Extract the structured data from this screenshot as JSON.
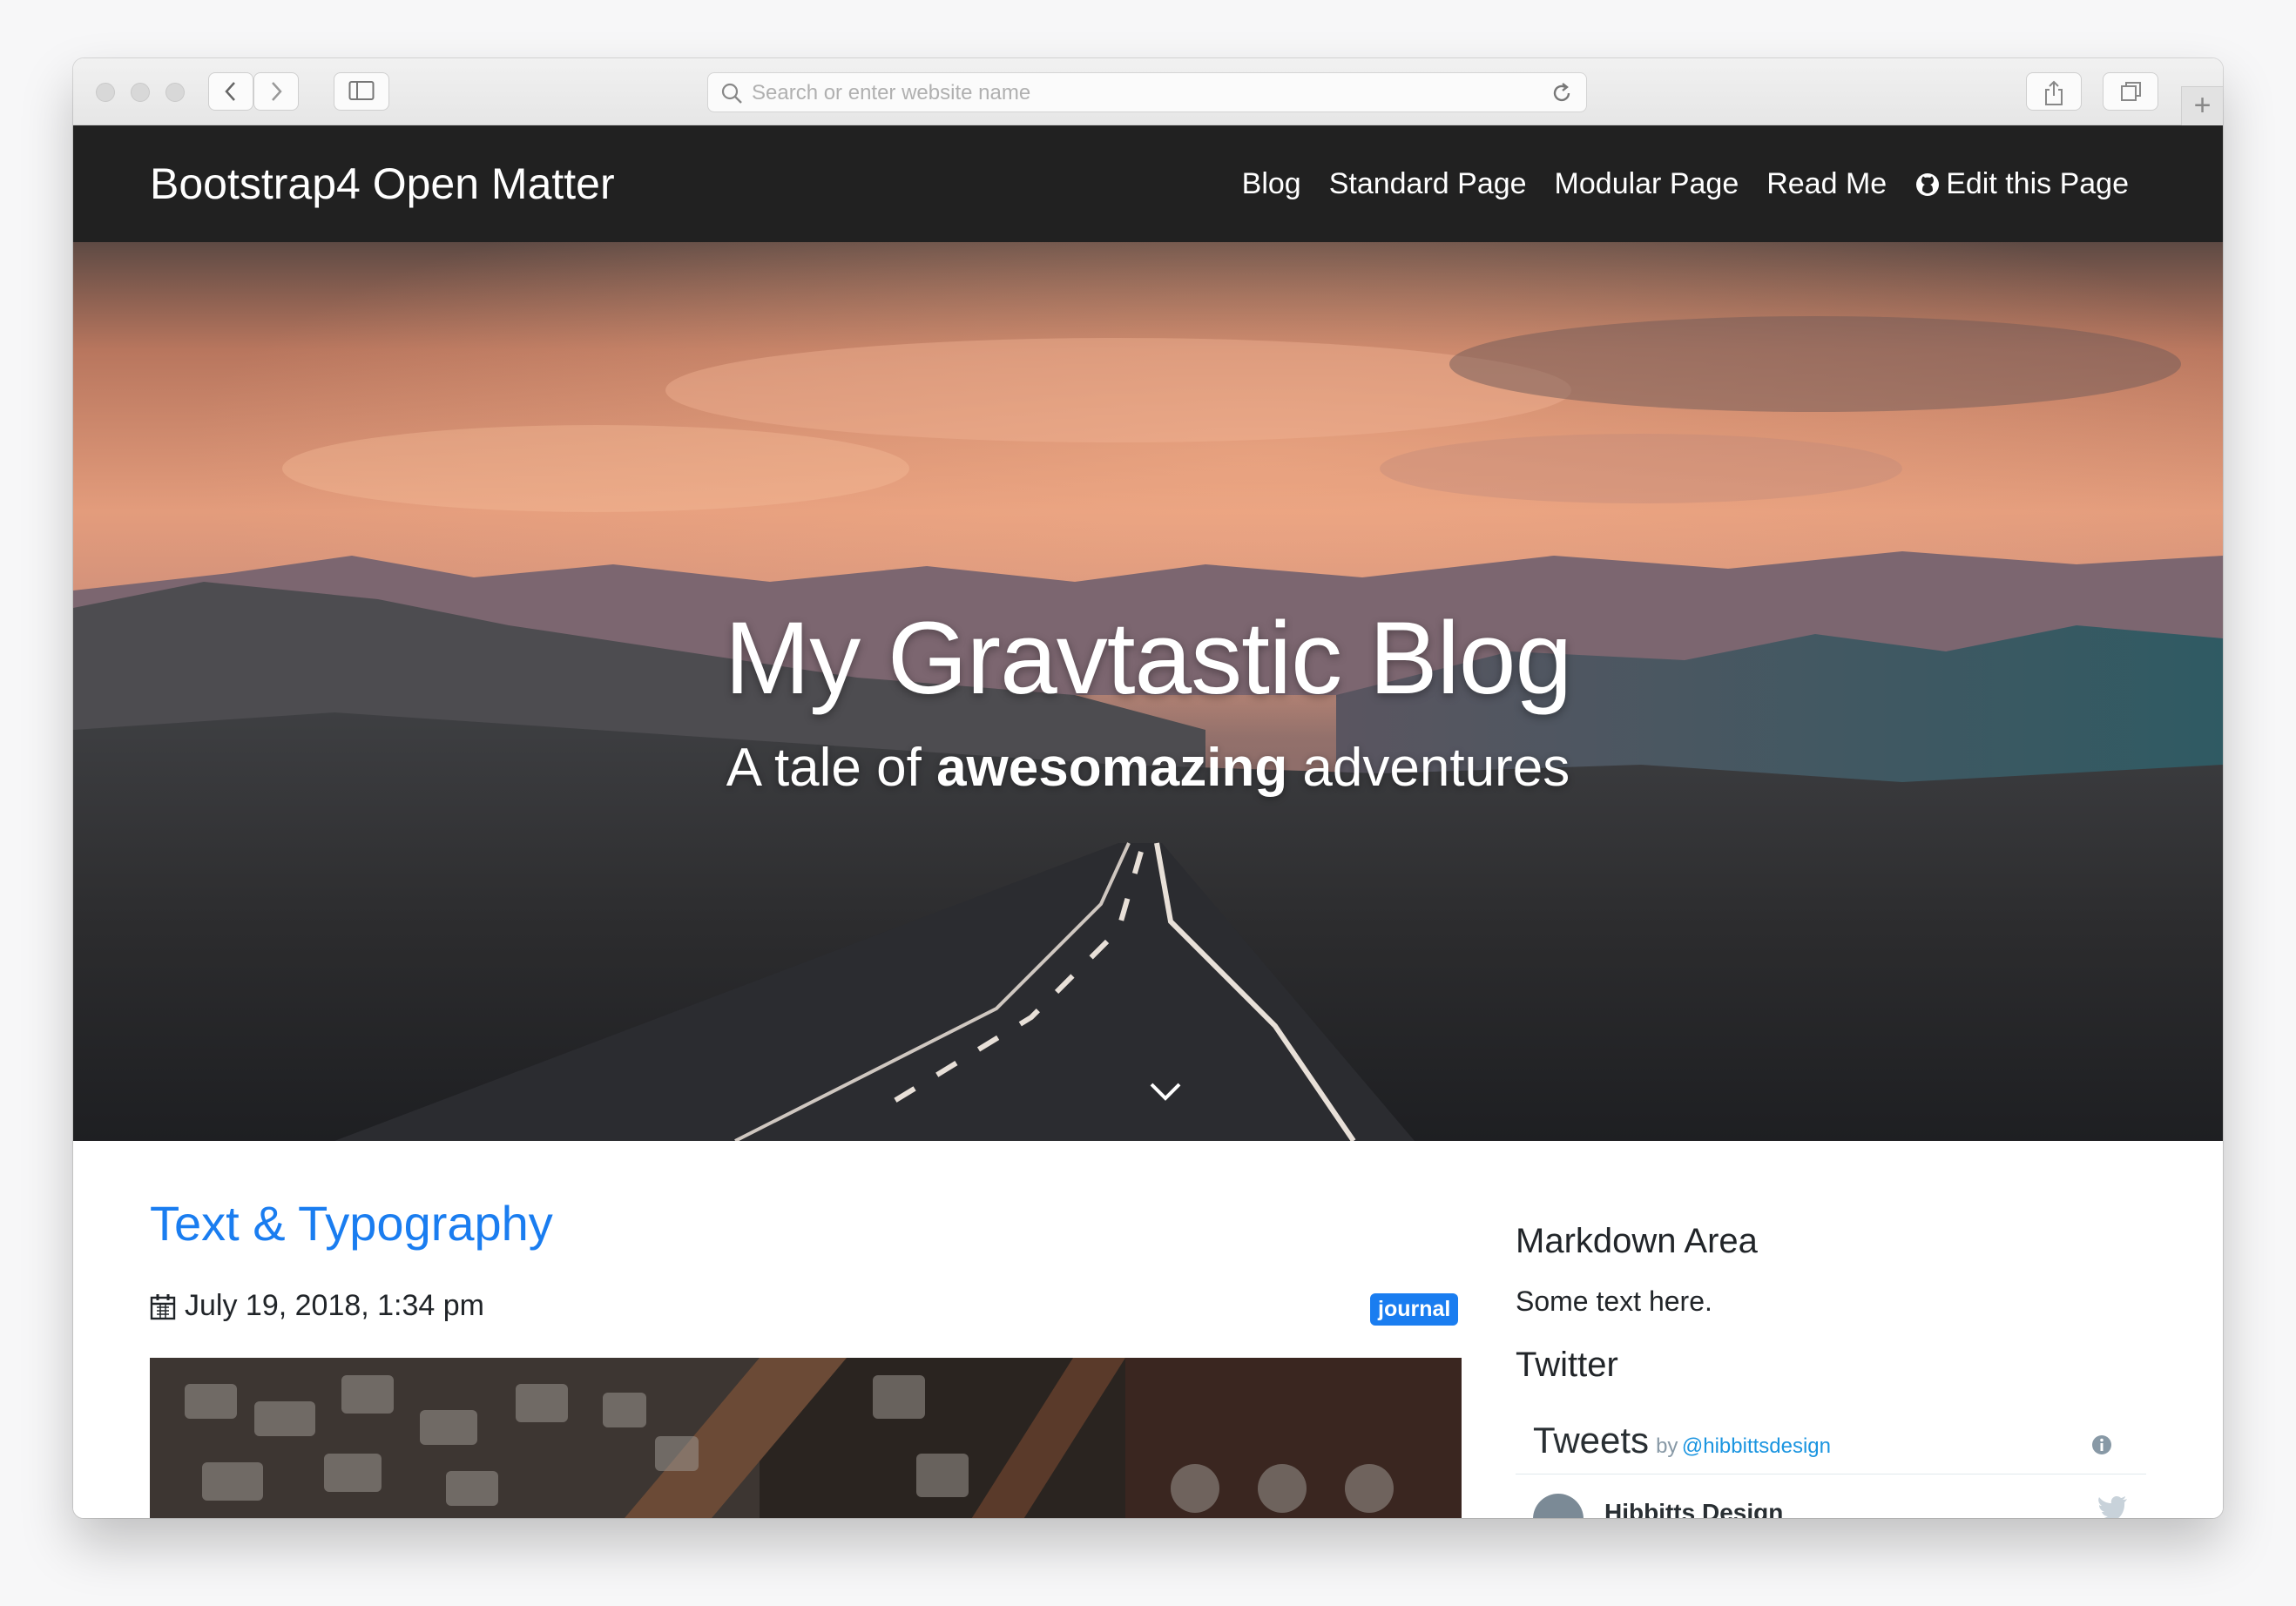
{
  "browser": {
    "address_placeholder": "Search or enter website name",
    "new_tab_label": "+"
  },
  "site": {
    "brand": "Bootstrap4 Open Matter",
    "nav": [
      "Blog",
      "Standard Page",
      "Modular Page",
      "Read Me",
      "Edit this Page"
    ]
  },
  "hero": {
    "title": "My Gravtastic Blog",
    "subtitle_pre": "A tale of ",
    "subtitle_bold": "awesomazing",
    "subtitle_post": " adventures"
  },
  "post": {
    "title": "Text & Typography",
    "date": "July 19, 2018, 1:34 pm",
    "tag": "journal"
  },
  "sidebar": {
    "markdown_heading": "Markdown Area",
    "markdown_text": "Some text here.",
    "twitter_heading": "Twitter",
    "tweets_title": "Tweets",
    "tweets_by": "by",
    "tweets_user": "@hibbittsdesign",
    "tweet_author": "Hibbitts Design"
  },
  "colors": {
    "navbar": "#212121",
    "link": "#1a7df0",
    "badge": "#1a7df0"
  }
}
